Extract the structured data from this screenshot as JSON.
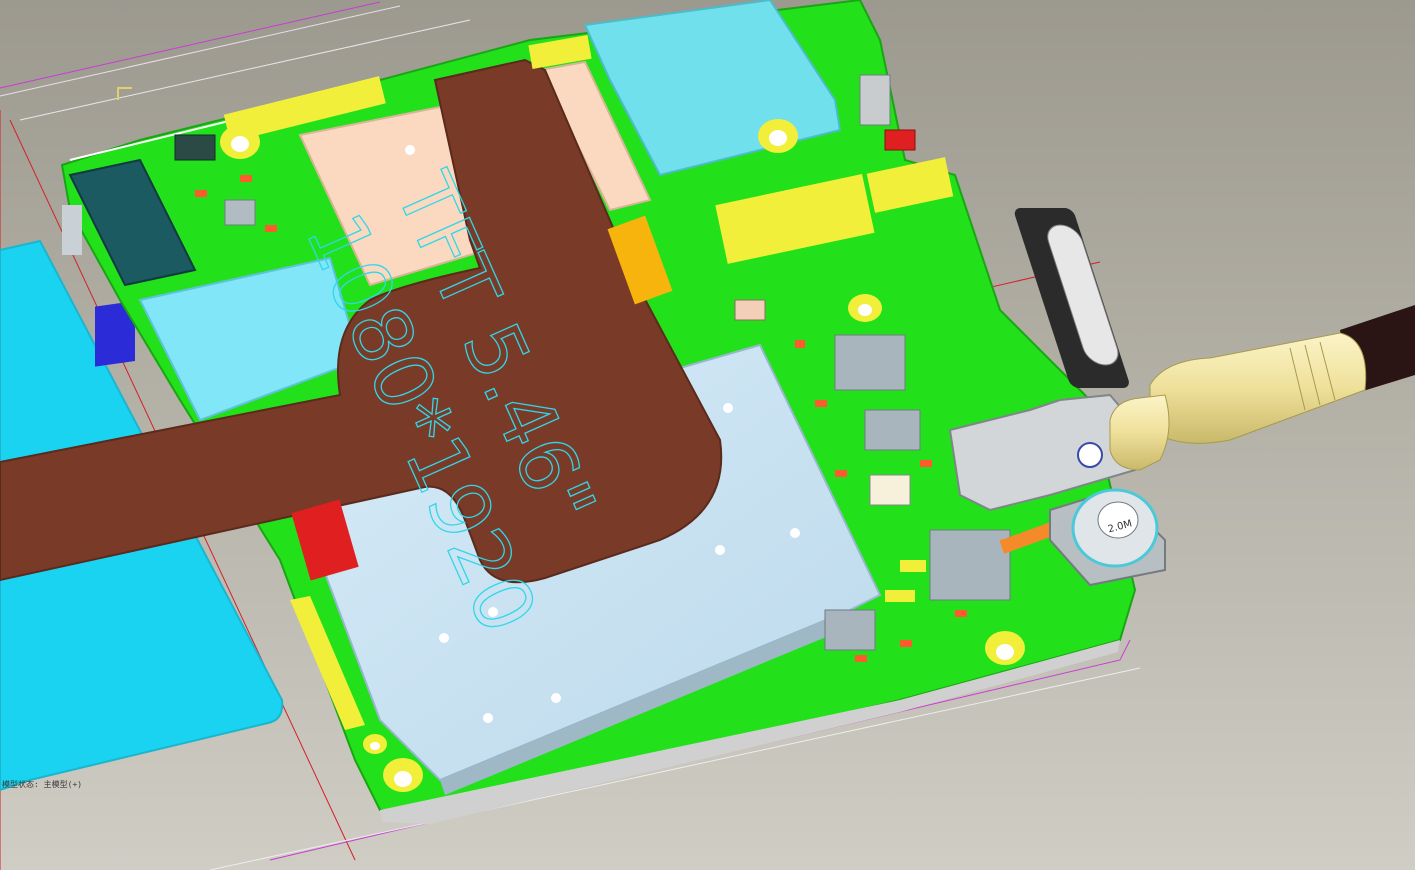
{
  "status_readout": "模型状态: 主模型(+)",
  "silkscreen": {
    "display_type": "TFT 5.46\"",
    "resolution": "1080*1920",
    "camera_label": "2.0M"
  },
  "colors": {
    "background": "#a9a69c",
    "pcb_green": "#22e01a",
    "fpc_brown": "#7a3a28",
    "shield_light_blue": "#c9e3f3",
    "battery_cyan": "#19d3f0",
    "silkscreen_outline": "#30d7e8",
    "pad_yellow": "#f2ef3a",
    "cable_plug": "#f0e3a2",
    "datum_line_red": "#d4202a"
  },
  "icons": [
    "view-triad-icon",
    "camera-module-icon",
    "audio-jack-icon",
    "mounting-hole-icon"
  ]
}
